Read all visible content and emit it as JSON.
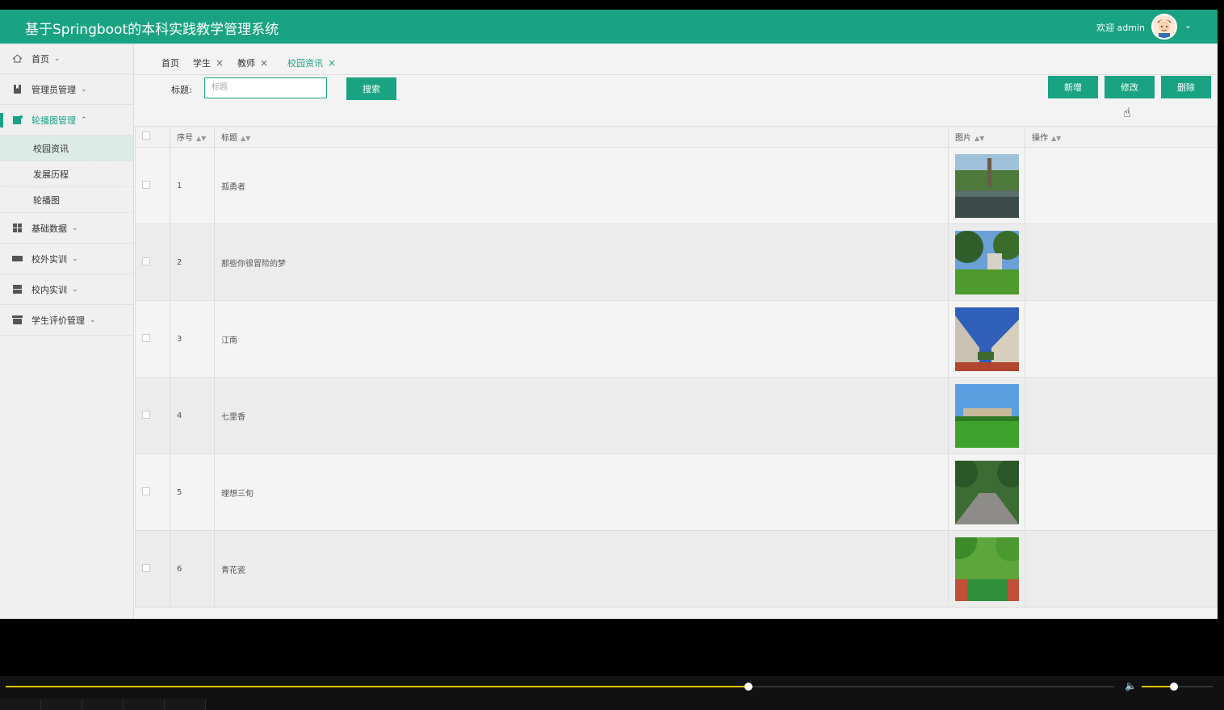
{
  "header": {
    "title": "基于Springboot的本科实践教学管理系统",
    "welcome": "欢迎 admin",
    "avatar_icon": "user-avatar",
    "dropdown_icon": "chevron-down-icon",
    "bg_color": "#1aa382"
  },
  "sidebar": {
    "items": [
      {
        "label": "首页",
        "icon": "home-icon",
        "arrow": "⌄"
      },
      {
        "label": "管理员管理",
        "icon": "bookmark-icon",
        "arrow": "⌄"
      },
      {
        "label": "轮播图管理",
        "icon": "image-edit-icon",
        "arrow": "⌃"
      },
      {
        "label": "基础数据",
        "icon": "grid-icon",
        "arrow": "⌄"
      },
      {
        "label": "校外实训",
        "icon": "box-icon",
        "arrow": "⌄"
      },
      {
        "label": "校内实训",
        "icon": "server-icon",
        "arrow": "⌄"
      },
      {
        "label": "学生评价管理",
        "icon": "archive-icon",
        "arrow": "⌄"
      }
    ],
    "subitems": [
      {
        "label": "校园资讯"
      },
      {
        "label": "发展历程"
      },
      {
        "label": "轮播图"
      }
    ]
  },
  "tabs": [
    {
      "label": "首页"
    },
    {
      "label": "学生",
      "close": "×"
    },
    {
      "label": "教师",
      "close": "×"
    },
    {
      "label": "校园资讯",
      "close": "×"
    }
  ],
  "search": {
    "label": "标题:",
    "placeholder": "标题",
    "button": "搜索"
  },
  "actions": {
    "add": "新增",
    "edit": "修改",
    "delete": "删除"
  },
  "table": {
    "columns": [
      "序号",
      "标题",
      "图片",
      "操作"
    ],
    "rows": [
      {
        "index": "1",
        "title": "孤勇者",
        "image": "campus-tower-lake"
      },
      {
        "index": "2",
        "title": "那些你很冒险的梦",
        "image": "campus-lawn-trees"
      },
      {
        "index": "3",
        "title": "江南",
        "image": "campus-buildings-sky"
      },
      {
        "index": "4",
        "title": "七里香",
        "image": "campus-field"
      },
      {
        "index": "5",
        "title": "理想三旬",
        "image": "campus-tree-road"
      },
      {
        "index": "6",
        "title": "青花瓷",
        "image": "campus-sports-track"
      }
    ]
  },
  "player": {
    "progress": 0.67,
    "volume": 0.45,
    "accent": "#e6c200"
  }
}
